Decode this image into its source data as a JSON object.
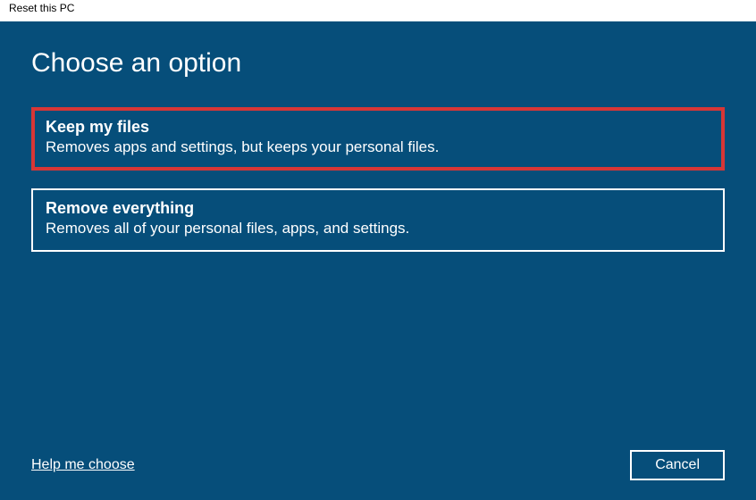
{
  "window": {
    "title": "Reset this PC"
  },
  "heading": "Choose an option",
  "options": [
    {
      "title": "Keep my files",
      "desc": "Removes apps and settings, but keeps your personal files."
    },
    {
      "title": "Remove everything",
      "desc": "Removes all of your personal files, apps, and settings."
    }
  ],
  "footer": {
    "help_link": "Help me choose",
    "cancel": "Cancel"
  }
}
